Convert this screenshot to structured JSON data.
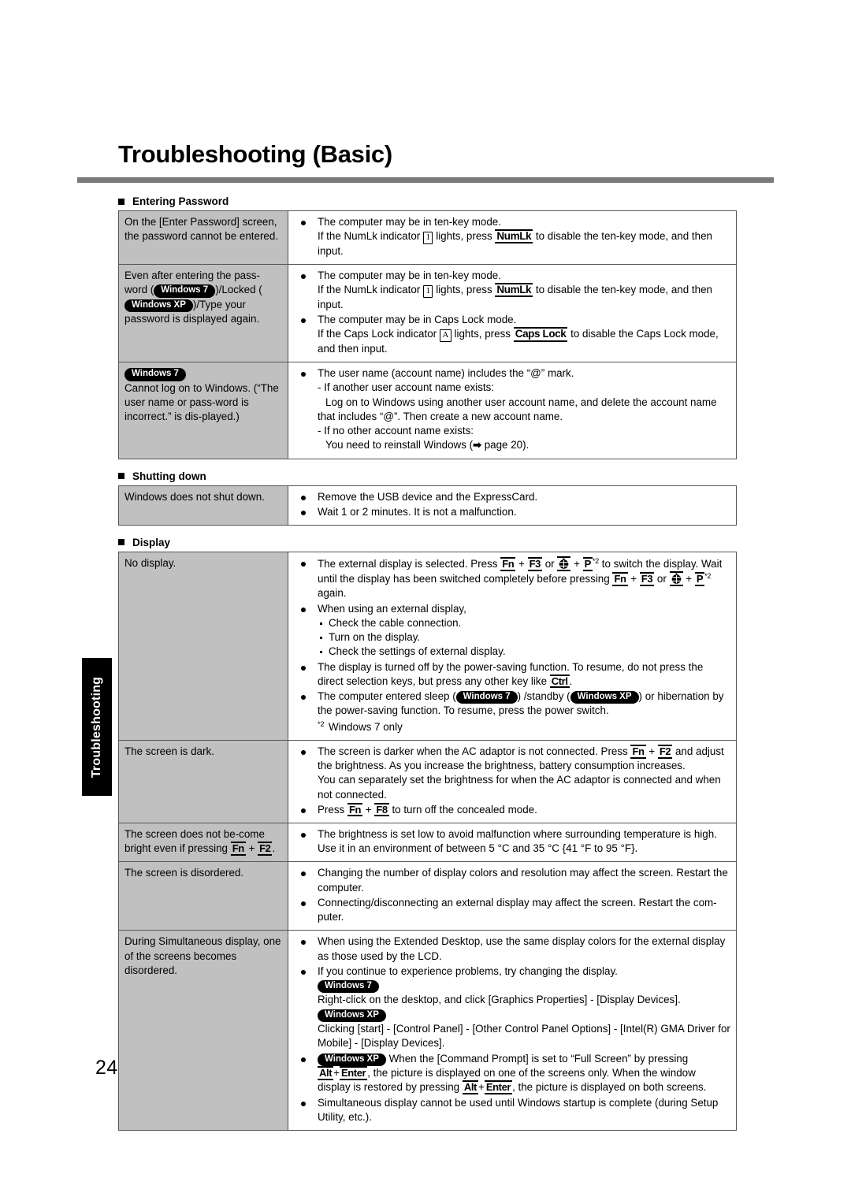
{
  "document": {
    "title": "Troubleshooting (Basic)",
    "page_number": "24",
    "side_tab_label": "Troubleshooting"
  },
  "badges": {
    "win7": "Windows 7",
    "winxp": "Windows XP"
  },
  "keys": {
    "numlk": "NumLk",
    "capslock": "Caps Lock",
    "fn": "Fn",
    "f2": "F2",
    "f3": "F3",
    "f8": "F8",
    "p": "P",
    "ctrl": "Ctrl",
    "alt": "Alt",
    "enter": "Enter"
  },
  "indicators": {
    "numlk_indicator": "1",
    "capslock_indicator": "A"
  },
  "sections": [
    {
      "heading": "Entering Password",
      "rows": [
        {
          "symptom": "On the [Enter Password] screen, the password cannot be entered.",
          "items": [
            "The computer may be in ten-key mode.",
            "If the NumLk indicator",
            "lights, press",
            "to disable the ten-key mode, and then input."
          ]
        },
        {
          "symptom_parts": {
            "a": "Even after entering the pass-word (",
            "b": ")/Locked (",
            "c": ")/Type your password is displayed again."
          },
          "items": [
            "The computer may be in ten-key mode.",
            "The computer may be in Caps Lock mode.",
            "If the Caps Lock indicator",
            "lights, press",
            "to disable the Caps Lock mode, and then input."
          ]
        },
        {
          "symptom_lines": [
            "Cannot log on to Windows.",
            "(“The user name or pass-word is incorrect.” is dis-played.)"
          ],
          "items": [
            "The user name (account name) includes the “@” mark.",
            "- If another user account name exists:",
            "Log on to Windows using another user account name, and delete the account name that includes “@”. Then create a new account name.",
            "- If no other account name exists:",
            "You need to reinstall Windows (",
            "page 20)."
          ]
        }
      ]
    },
    {
      "heading": "Shutting down",
      "rows": [
        {
          "symptom": "Windows does not shut down.",
          "items": [
            "Remove the USB device and the ExpressCard.",
            "Wait 1 or 2 minutes. It is not a malfunction."
          ]
        }
      ]
    },
    {
      "heading": "Display",
      "rows": [
        {
          "symptom": "No display.",
          "items": [
            "The external display is selected. Press",
            "or",
            "to switch the display. Wait until the display has been switched completely before pressing",
            "again.",
            "When using an external display,",
            "Check the cable connection.",
            "Turn on the display.",
            "Check the settings of external display.",
            "The display is turned off by the power-saving function. To resume, do not press the direct selection keys, but press any other key like",
            "The computer entered sleep (",
            ") /standby (",
            ") or hibernation by the power-saving function. To resume, press the power switch.",
            "Windows 7 only"
          ],
          "footnote_marker": "*2"
        },
        {
          "symptom": "The screen is dark.",
          "items": [
            "The screen is darker when the AC adaptor is not connected. Press",
            "and adjust the brightness. As you increase the brightness, battery consumption increases.",
            "You can separately set the brightness for when the AC adaptor is connected and when not connected.",
            "Press",
            "to turn off the concealed mode."
          ]
        },
        {
          "symptom_parts": {
            "a": "The screen does not be-come bright even if pressing",
            "b": "."
          },
          "items": [
            "The brightness is set low to avoid malfunction where surrounding temperature is high. Use it in an environment of between 5 °C and 35 °C {41 °F to 95 °F}."
          ]
        },
        {
          "symptom": "The screen is disordered.",
          "items": [
            "Changing the number of display colors and resolution may affect the screen. Restart the computer.",
            "Connecting/disconnecting an external display may affect the screen. Restart the com-puter."
          ]
        },
        {
          "symptom": "During Simultaneous display, one of the screens becomes disordered.",
          "items": [
            "When using the Extended Desktop, use the same display colors for the external display as those used by the LCD.",
            "If you continue to experience problems, try changing the display.",
            "Right-click on the desktop, and click [Graphics Properties] - [Display Devices].",
            "Clicking [start] - [Control Panel] - [Other Control Panel Options] - [Intel(R) GMA Driver for Mobile] - [Display Devices].",
            "When the [Command Prompt] is set to “Full Screen” by pressing",
            ", the picture is displayed on one of the screens only. When the window display is restored by pressing",
            ", the picture is displayed on both screens.",
            "Simultaneous display cannot be used until Windows startup is complete (during Setup Utility, etc.)."
          ]
        }
      ]
    }
  ]
}
